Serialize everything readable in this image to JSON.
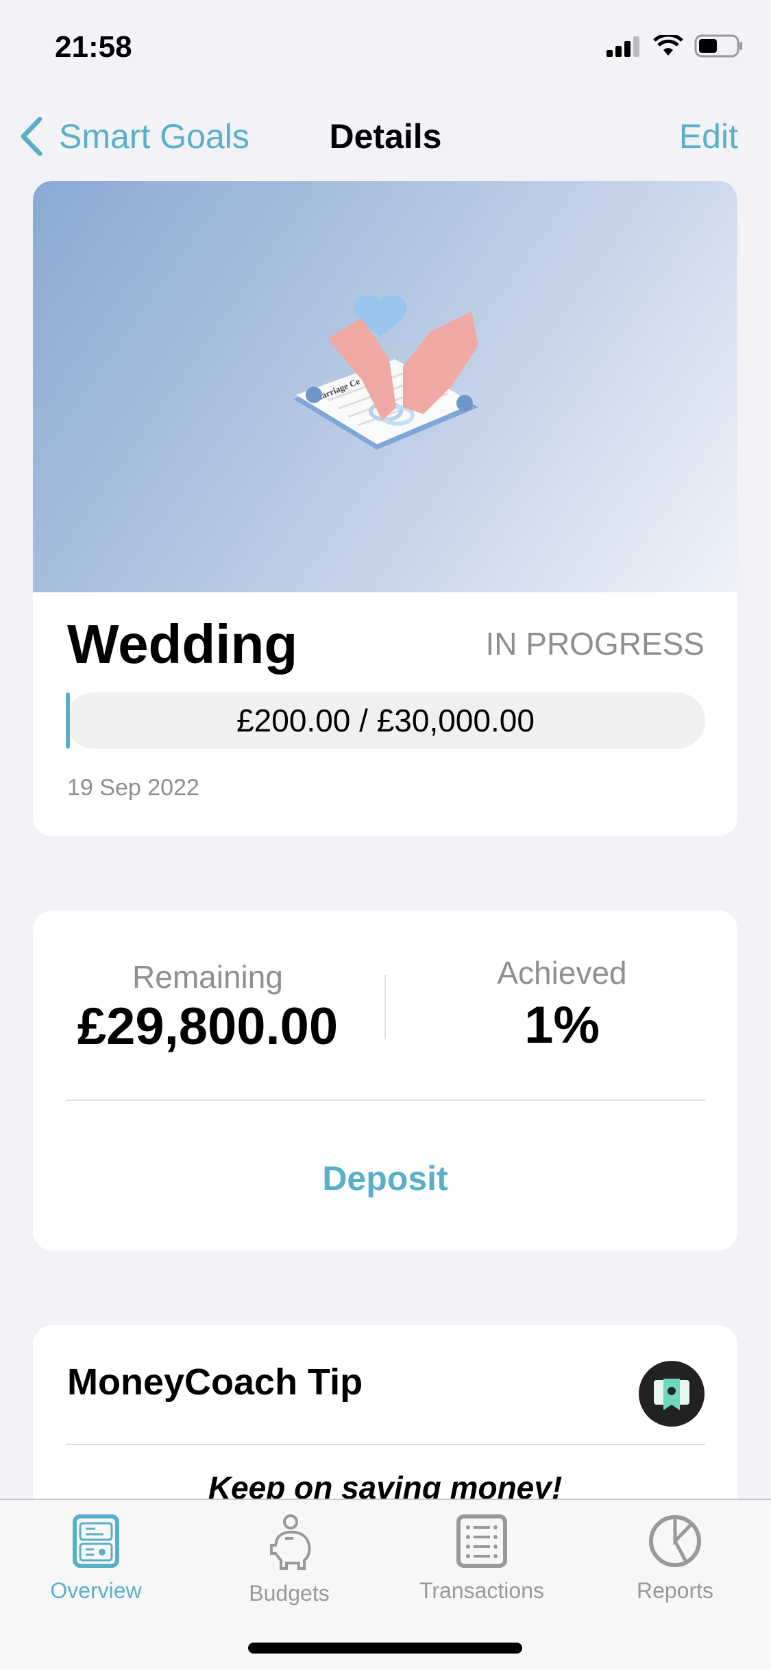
{
  "status_bar": {
    "time": "21:58"
  },
  "nav": {
    "back_label": "Smart Goals",
    "title": "Details",
    "edit_label": "Edit"
  },
  "goal": {
    "name": "Wedding",
    "status": "IN PROGRESS",
    "progress_text": "£200.00 / £30,000.00",
    "progress_fraction": 0.0067,
    "date": "19 Sep 2022",
    "illustration_text": "Marriage Ce"
  },
  "summary": {
    "remaining_label": "Remaining",
    "remaining_value": "£29,800.00",
    "achieved_label": "Achieved",
    "achieved_value": "1%",
    "deposit_label": "Deposit"
  },
  "tip": {
    "title": "MoneyCoach Tip",
    "text": "Keep on saving money!"
  },
  "tabs": [
    {
      "label": "Overview",
      "icon": "overview-icon",
      "active": true
    },
    {
      "label": "Budgets",
      "icon": "piggy-bank-icon"
    },
    {
      "label": "Transactions",
      "icon": "list-icon"
    },
    {
      "label": "Reports",
      "icon": "pie-chart-icon"
    }
  ],
  "colors": {
    "accent": "#5aafc8",
    "background": "#f2f2f7",
    "inactive": "#999999"
  }
}
